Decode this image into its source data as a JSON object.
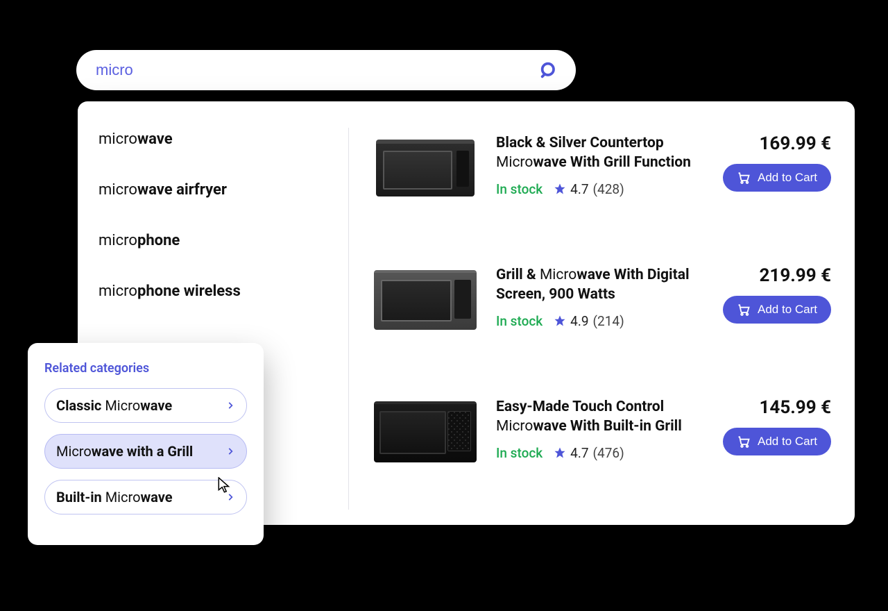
{
  "search": {
    "value": "micro"
  },
  "suggestions": [
    {
      "pre": "micro",
      "hl": "wave"
    },
    {
      "pre": "micro",
      "hl": "wave airfryer"
    },
    {
      "pre": "micro",
      "hl": "phone"
    },
    {
      "pre": "micro",
      "hl": "phone wireless"
    }
  ],
  "products": [
    {
      "title_bold1": "Black & Silver Countertop",
      "title_plain": " Micro",
      "title_bold2": "wave With Grill Function",
      "stock": "In stock",
      "rating": "4.7",
      "reviews": "(428)",
      "price": "169.99 €",
      "cart_label": "Add to Cart"
    },
    {
      "title_bold1": "Grill & ",
      "title_plain": "Micro",
      "title_bold2": "wave With Digital Screen, 900 Watts",
      "stock": "In stock",
      "rating": "4.9",
      "reviews": "(214)",
      "price": "219.99 €",
      "cart_label": "Add to Cart"
    },
    {
      "title_bold1": "Easy-Made Touch Control ",
      "title_plain": "Micro",
      "title_bold2": "wave With Built-in Grill",
      "stock": "In stock",
      "rating": "4.7",
      "reviews": "(476)",
      "price": "145.99 €",
      "cart_label": "Add to Cart"
    }
  ],
  "related": {
    "title": "Related categories",
    "items": [
      {
        "bold1": "Classic ",
        "plain": "Micro",
        "bold2": "wave"
      },
      {
        "bold1": "",
        "plain": "Micro",
        "bold2": "wave with a Grill"
      },
      {
        "bold1": "Built-in ",
        "plain": "Micro",
        "bold2": "wave"
      }
    ]
  }
}
